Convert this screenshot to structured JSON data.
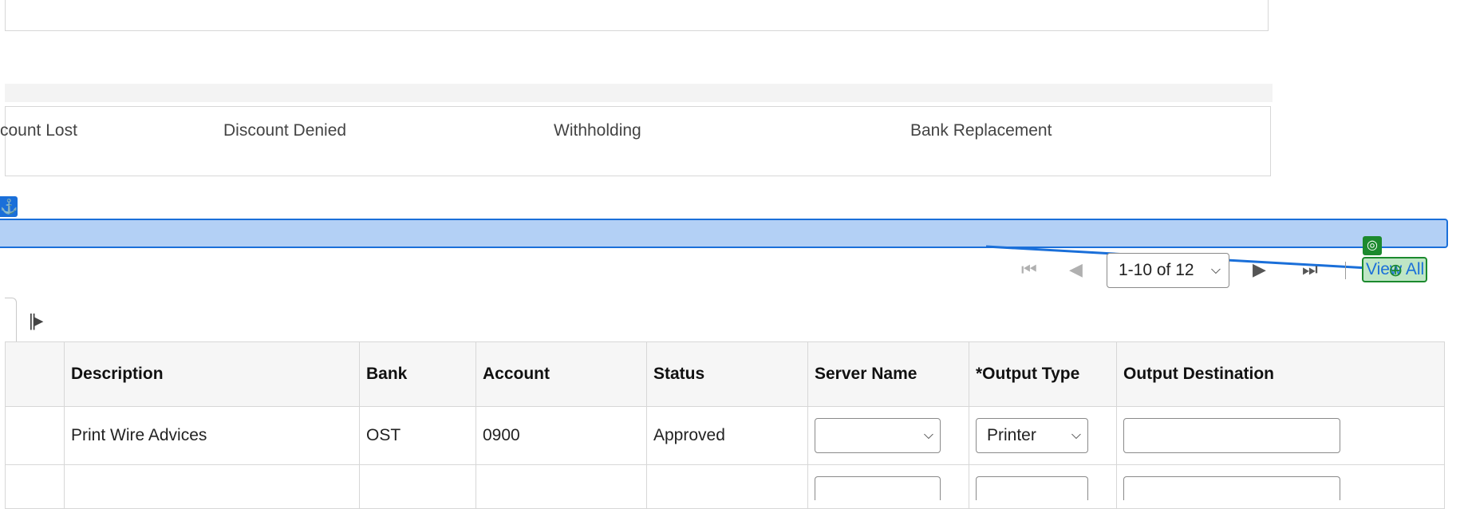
{
  "discount_section": {
    "labels": [
      "count Lost",
      "Discount Denied",
      "Withholding",
      "Bank Replacement"
    ]
  },
  "overlay": {
    "anchor_icon": "anchor-icon",
    "target_icon": "target-icon",
    "crosshair_icon": "crosshair-icon",
    "highlight_color": "#b3d0f5",
    "accent_color": "#1a6fd9",
    "target_color": "#1c8a2e"
  },
  "pager": {
    "range_label": "1-10 of 12",
    "view_all_label": "View All",
    "icons": [
      "first-page-icon",
      "previous-page-icon",
      "next-page-icon",
      "last-page-icon"
    ]
  },
  "grid": {
    "columns": [
      "Description",
      "Bank",
      "Account",
      "Status",
      "Server Name",
      "*Output Type",
      "Output Destination"
    ],
    "rows": [
      {
        "description": "Print Wire Advices",
        "bank": "OST",
        "account": "0900",
        "status": "Approved",
        "server_name": "",
        "output_type": "Printer",
        "output_destination": ""
      }
    ]
  }
}
